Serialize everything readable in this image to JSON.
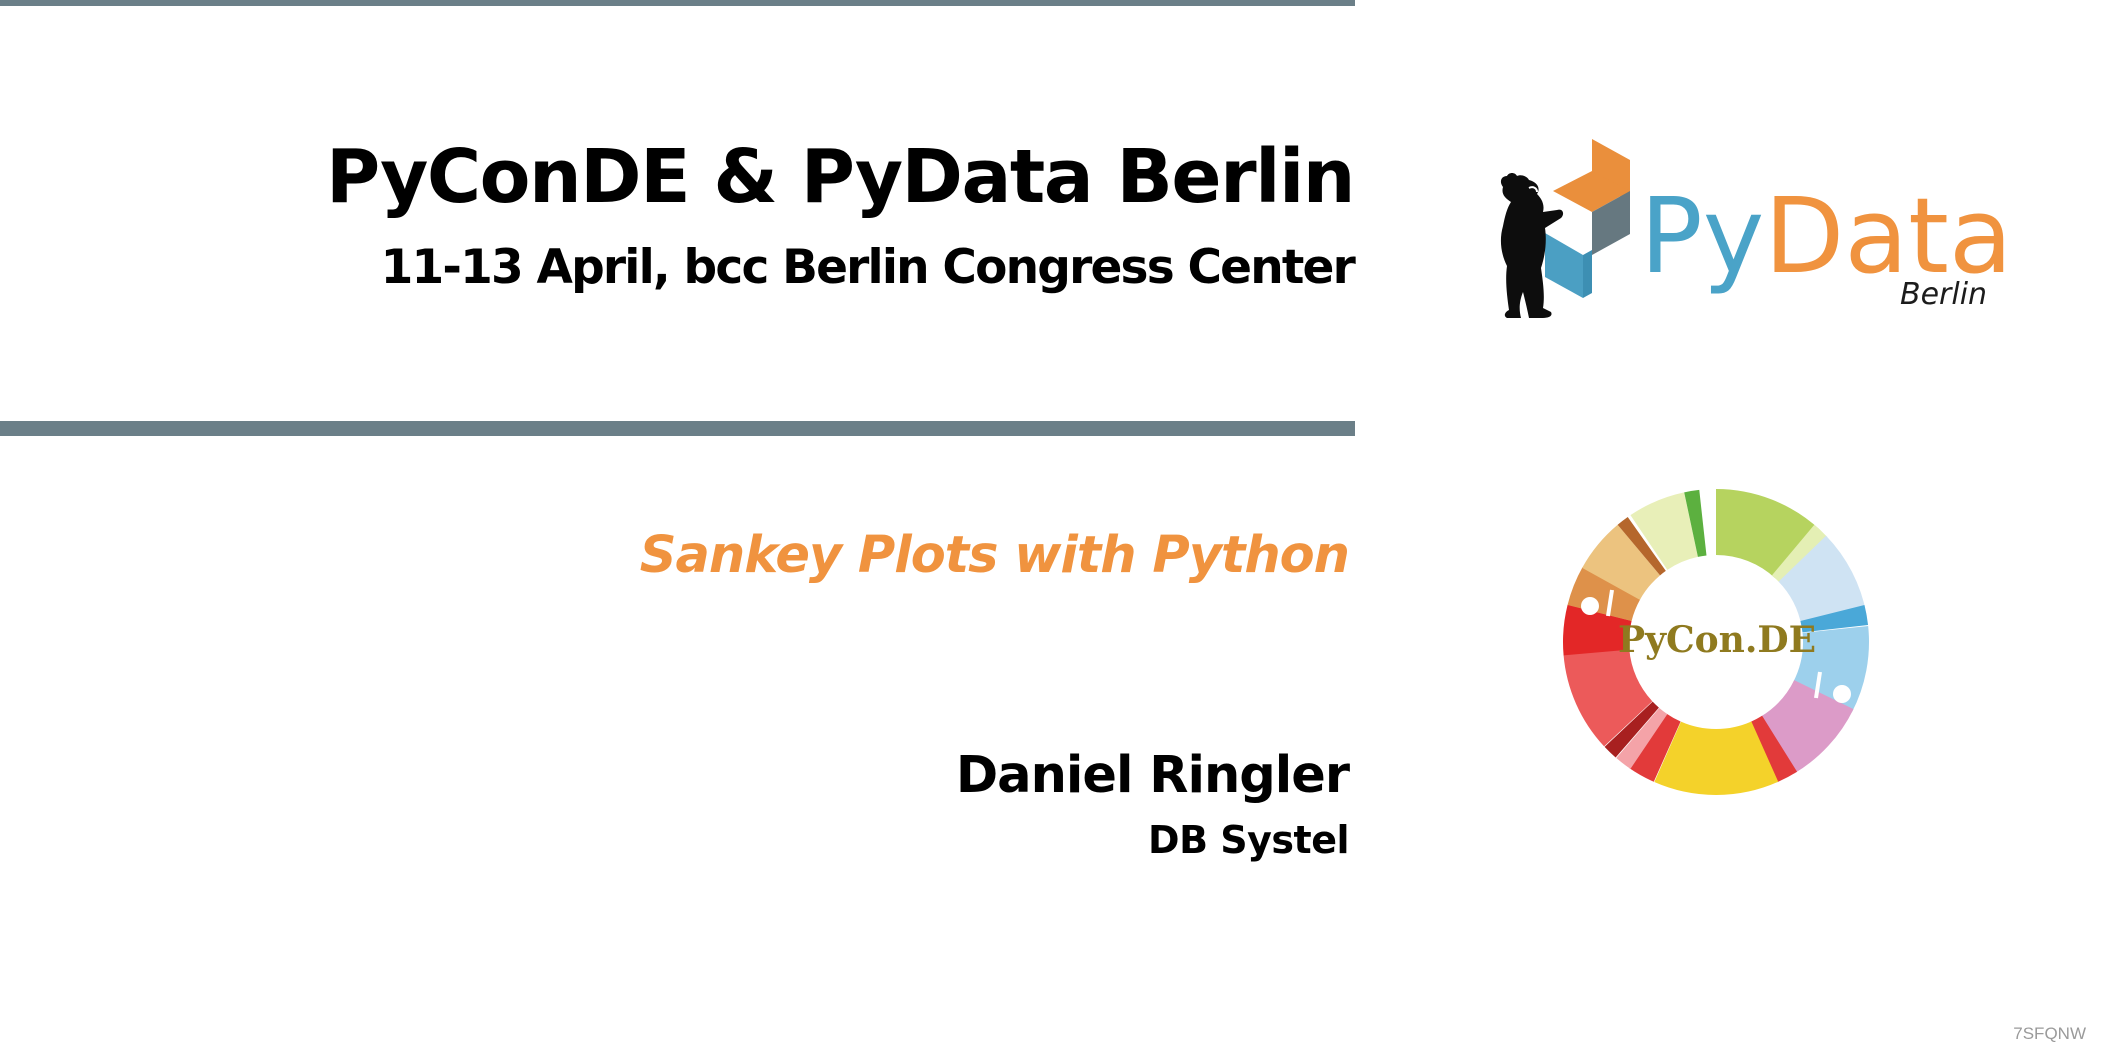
{
  "conference": {
    "title": "PyConDE & PyData Berlin",
    "subtitle": "11-13 April, bcc Berlin Congress Center"
  },
  "talk": {
    "title": "Sankey Plots with Python",
    "speaker": "Daniel Ringler",
    "company": "DB Systel"
  },
  "logos": {
    "pydata": {
      "py": "Py",
      "data": "Data",
      "city": "Berlin",
      "icon": "bear-cubes-icon"
    },
    "pycon": {
      "text": "PyCon.DE",
      "icon": "snake-ring-icon"
    }
  },
  "footer": {
    "slide_id": "7SFQNW"
  },
  "colors": {
    "divider": "#6b7f88",
    "accent_orange": "#f0933f",
    "pydata_blue": "#4aa3c8",
    "pycon_gold": "#8f7a1f"
  }
}
